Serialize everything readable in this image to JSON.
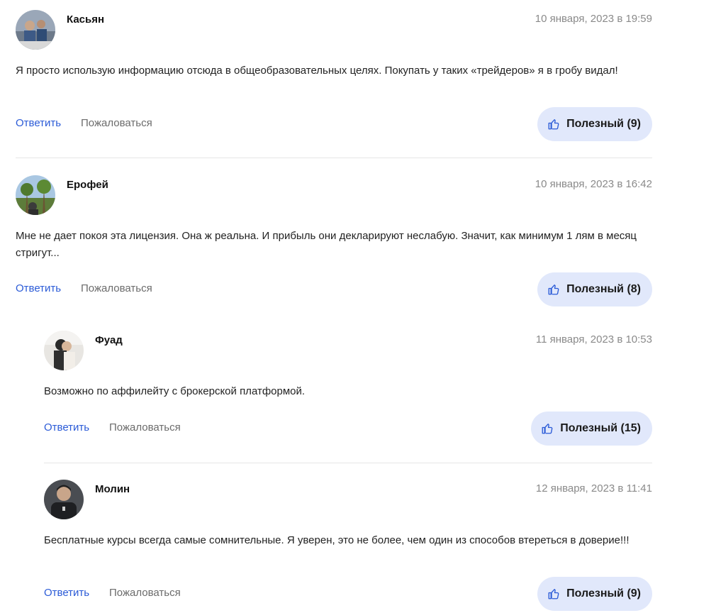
{
  "comments": [
    {
      "author": "Касьян",
      "date": "10 января, 2023 в 19:59",
      "text": "Я просто использую информацию отсюда в общеобразовательных целях. Покупать у таких «трейдеров» я в гробу видал!",
      "reply_label": "Ответить",
      "report_label": "Пожаловаться",
      "useful_label": "Полезный (9)"
    },
    {
      "author": "Ерофей",
      "date": "10 января, 2023 в 16:42",
      "text": "Мне не дает покоя эта лицензия. Она ж реальна. И прибыль они декларируют неслабую. Значит, как минимум 1 лям в месяц стригут...",
      "reply_label": "Ответить",
      "report_label": "Пожаловаться",
      "useful_label": "Полезный (8)"
    },
    {
      "author": "Фуад",
      "date": "11 января, 2023 в 10:53",
      "text": "Возможно по аффилейту с брокерской платформой.",
      "reply_label": "Ответить",
      "report_label": "Пожаловаться",
      "useful_label": "Полезный (15)"
    },
    {
      "author": "Молин",
      "date": "12 января, 2023 в 11:41",
      "text": "Бесплатные курсы всегда самые сомнительные. Я уверен, это не более, чем один из способов втереться в доверие!!!",
      "reply_label": "Ответить",
      "report_label": "Пожаловаться",
      "useful_label": "Полезный (9)"
    }
  ],
  "icons": {
    "useful": "thumbs-up-icon"
  },
  "colors": {
    "reply_link": "#2b5bd7",
    "useful_button_bg": "#e1e8fb",
    "date_text": "#8a8a8a"
  }
}
